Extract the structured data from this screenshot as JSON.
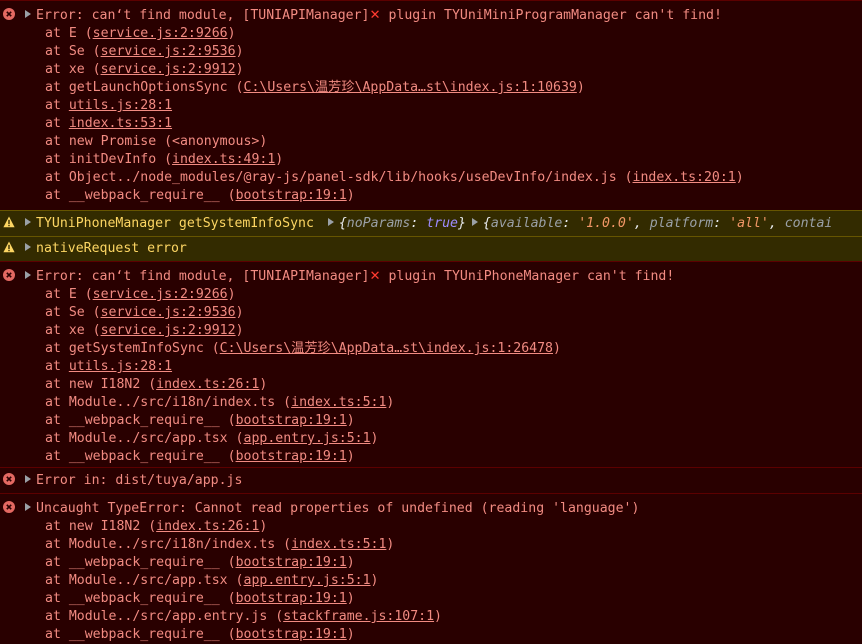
{
  "entries": [
    {
      "level": "error",
      "head": {
        "prefix": "Error: can‘t find module, [TUNIAPIManager]",
        "x": "✕",
        "suffix": " plugin TYUniMiniProgramManager can't find!"
      },
      "frames": [
        {
          "pre": "at E (",
          "link": "service.js:2:9266",
          "post": ")"
        },
        {
          "pre": "at Se (",
          "link": "service.js:2:9536",
          "post": ")"
        },
        {
          "pre": "at xe (",
          "link": "service.js:2:9912",
          "post": ")"
        },
        {
          "pre": "at getLaunchOptionsSync (",
          "link": "C:\\Users\\温芳珍\\AppData…st\\index.js:1:10639",
          "post": ")"
        },
        {
          "pre": "at ",
          "link": "utils.js:28:1",
          "post": ""
        },
        {
          "pre": "at ",
          "link": "index.ts:53:1",
          "post": ""
        },
        {
          "pre": "at new Promise (<anonymous>)",
          "link": "",
          "post": ""
        },
        {
          "pre": "at initDevInfo (",
          "link": "index.ts:49:1",
          "post": ")"
        },
        {
          "pre": "at Object../node_modules/@ray-js/panel-sdk/lib/hooks/useDevInfo/index.js (",
          "link": "index.ts:20:1",
          "post": ")"
        },
        {
          "pre": "at __webpack_require__ (",
          "link": "bootstrap:19:1",
          "post": ")"
        }
      ]
    },
    {
      "level": "warning",
      "head": {
        "text": "TYUniPhoneManager getSystemInfoSync ",
        "obj1": {
          "key": "noParams",
          "value": "true"
        },
        "obj2": {
          "k1": "available",
          "v1": "'1.0.0'",
          "k2": "platform",
          "v2": "'all'",
          "k3": "contai"
        }
      }
    },
    {
      "level": "warning",
      "head": {
        "text": "nativeRequest error"
      }
    },
    {
      "level": "error",
      "head": {
        "prefix": "Error: can‘t find module, [TUNIAPIManager]",
        "x": "✕",
        "suffix": " plugin TYUniPhoneManager can't find!"
      },
      "frames": [
        {
          "pre": "at E (",
          "link": "service.js:2:9266",
          "post": ")"
        },
        {
          "pre": "at Se (",
          "link": "service.js:2:9536",
          "post": ")"
        },
        {
          "pre": "at xe (",
          "link": "service.js:2:9912",
          "post": ")"
        },
        {
          "pre": "at getSystemInfoSync (",
          "link": "C:\\Users\\温芳珍\\AppData…st\\index.js:1:26478",
          "post": ")"
        },
        {
          "pre": "at ",
          "link": "utils.js:28:1",
          "post": ""
        },
        {
          "pre": "at new I18N2 (",
          "link": "index.ts:26:1",
          "post": ")"
        },
        {
          "pre": "at Module../src/i18n/index.ts (",
          "link": "index.ts:5:1",
          "post": ")"
        },
        {
          "pre": "at __webpack_require__ (",
          "link": "bootstrap:19:1",
          "post": ")"
        },
        {
          "pre": "at Module../src/app.tsx (",
          "link": "app.entry.js:5:1",
          "post": ")"
        },
        {
          "pre": "at __webpack_require__ (",
          "link": "bootstrap:19:1",
          "post": ")"
        }
      ]
    },
    {
      "level": "error",
      "head": {
        "prefix": "Error in: dist/tuya/app.js"
      }
    },
    {
      "level": "error",
      "head": {
        "prefix": "Uncaught TypeError: Cannot read properties of undefined (reading 'language')"
      },
      "frames": [
        {
          "pre": "at new I18N2 (",
          "link": "index.ts:26:1",
          "post": ")"
        },
        {
          "pre": "at Module../src/i18n/index.ts (",
          "link": "index.ts:5:1",
          "post": ")"
        },
        {
          "pre": "at __webpack_require__ (",
          "link": "bootstrap:19:1",
          "post": ")"
        },
        {
          "pre": "at Module../src/app.tsx (",
          "link": "app.entry.js:5:1",
          "post": ")"
        },
        {
          "pre": "at __webpack_require__ (",
          "link": "bootstrap:19:1",
          "post": ")"
        },
        {
          "pre": "at Module../src/app.entry.js (",
          "link": "stackframe.js:107:1",
          "post": ")"
        },
        {
          "pre": "at __webpack_require__ (",
          "link": "bootstrap:19:1",
          "post": ")"
        }
      ]
    }
  ]
}
